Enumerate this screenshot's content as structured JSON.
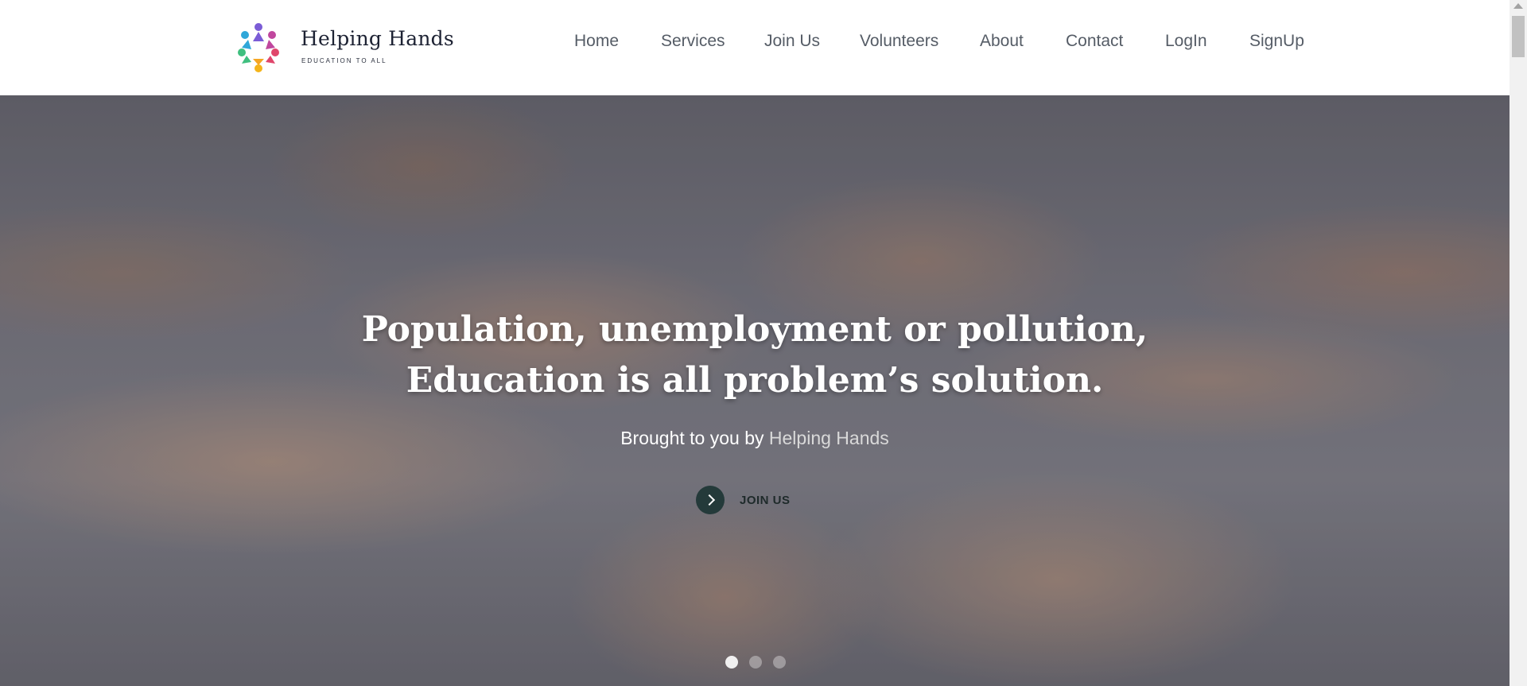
{
  "brand": {
    "name": "Helping Hands",
    "tagline": "EDUCATION TO ALL",
    "logo_icon": "hands-circle-logo"
  },
  "nav": {
    "items": [
      "Home",
      "Services",
      "Join Us",
      "Volunteers",
      "About",
      "Contact",
      "LogIn",
      "SignUp"
    ]
  },
  "hero": {
    "title_line1": "Population, unemployment or pollution,",
    "title_line2": "Education is all problem’s solution.",
    "subtitle_prefix": "Brought to you by",
    "subtitle_brand": "Helping Hands",
    "cta_label": "JOIN US",
    "cta_icon": "chevron-right-icon",
    "slides": 3,
    "active_slide": 1
  },
  "colors": {
    "accent_button": "#243a3a",
    "nav_text": "#555c66",
    "brand_text": "#1d2233"
  }
}
